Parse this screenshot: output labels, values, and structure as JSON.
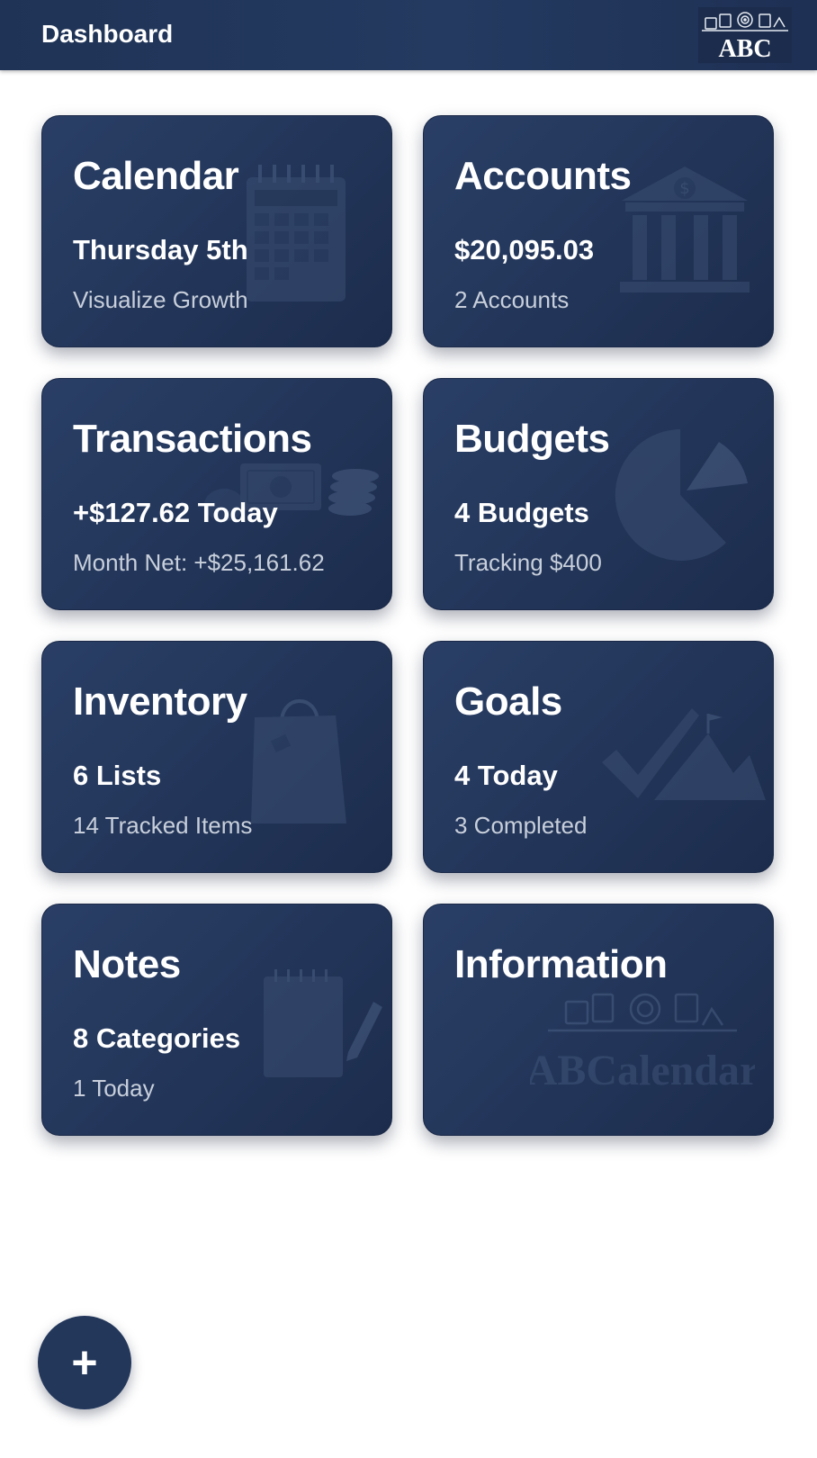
{
  "header": {
    "title": "Dashboard",
    "logo_text": "ABC"
  },
  "cards": [
    {
      "title": "Calendar",
      "primary": "Thursday 5th",
      "secondary": "Visualize Growth",
      "icon": "calendar-icon"
    },
    {
      "title": "Accounts",
      "primary": "$20,095.03",
      "secondary": "2 Accounts",
      "icon": "bank-icon"
    },
    {
      "title": "Transactions",
      "primary": "+$127.62 Today",
      "secondary": "Month Net: +$25,161.62",
      "icon": "money-icon"
    },
    {
      "title": "Budgets",
      "primary": "4 Budgets",
      "secondary": "Tracking $400",
      "icon": "pie-chart-icon"
    },
    {
      "title": "Inventory",
      "primary": "6 Lists",
      "secondary": "14 Tracked Items",
      "icon": "shopping-bag-icon"
    },
    {
      "title": "Goals",
      "primary": "4 Today",
      "secondary": "3 Completed",
      "icon": "checkmark-mountain-icon"
    },
    {
      "title": "Notes",
      "primary": "8 Categories",
      "secondary": "1 Today",
      "icon": "notepad-pencil-icon"
    },
    {
      "title": "Information",
      "primary": "",
      "secondary": "",
      "icon": "abcalendar-logo-icon",
      "watermark": "ABCalendar"
    }
  ],
  "fab": {
    "label": "+"
  },
  "colors": {
    "header_bg": "#233a5f",
    "card_bg": "#23365a",
    "card_text": "#ffffff",
    "card_subtext": "#c8cfdb",
    "fab_bg": "#23375b"
  }
}
